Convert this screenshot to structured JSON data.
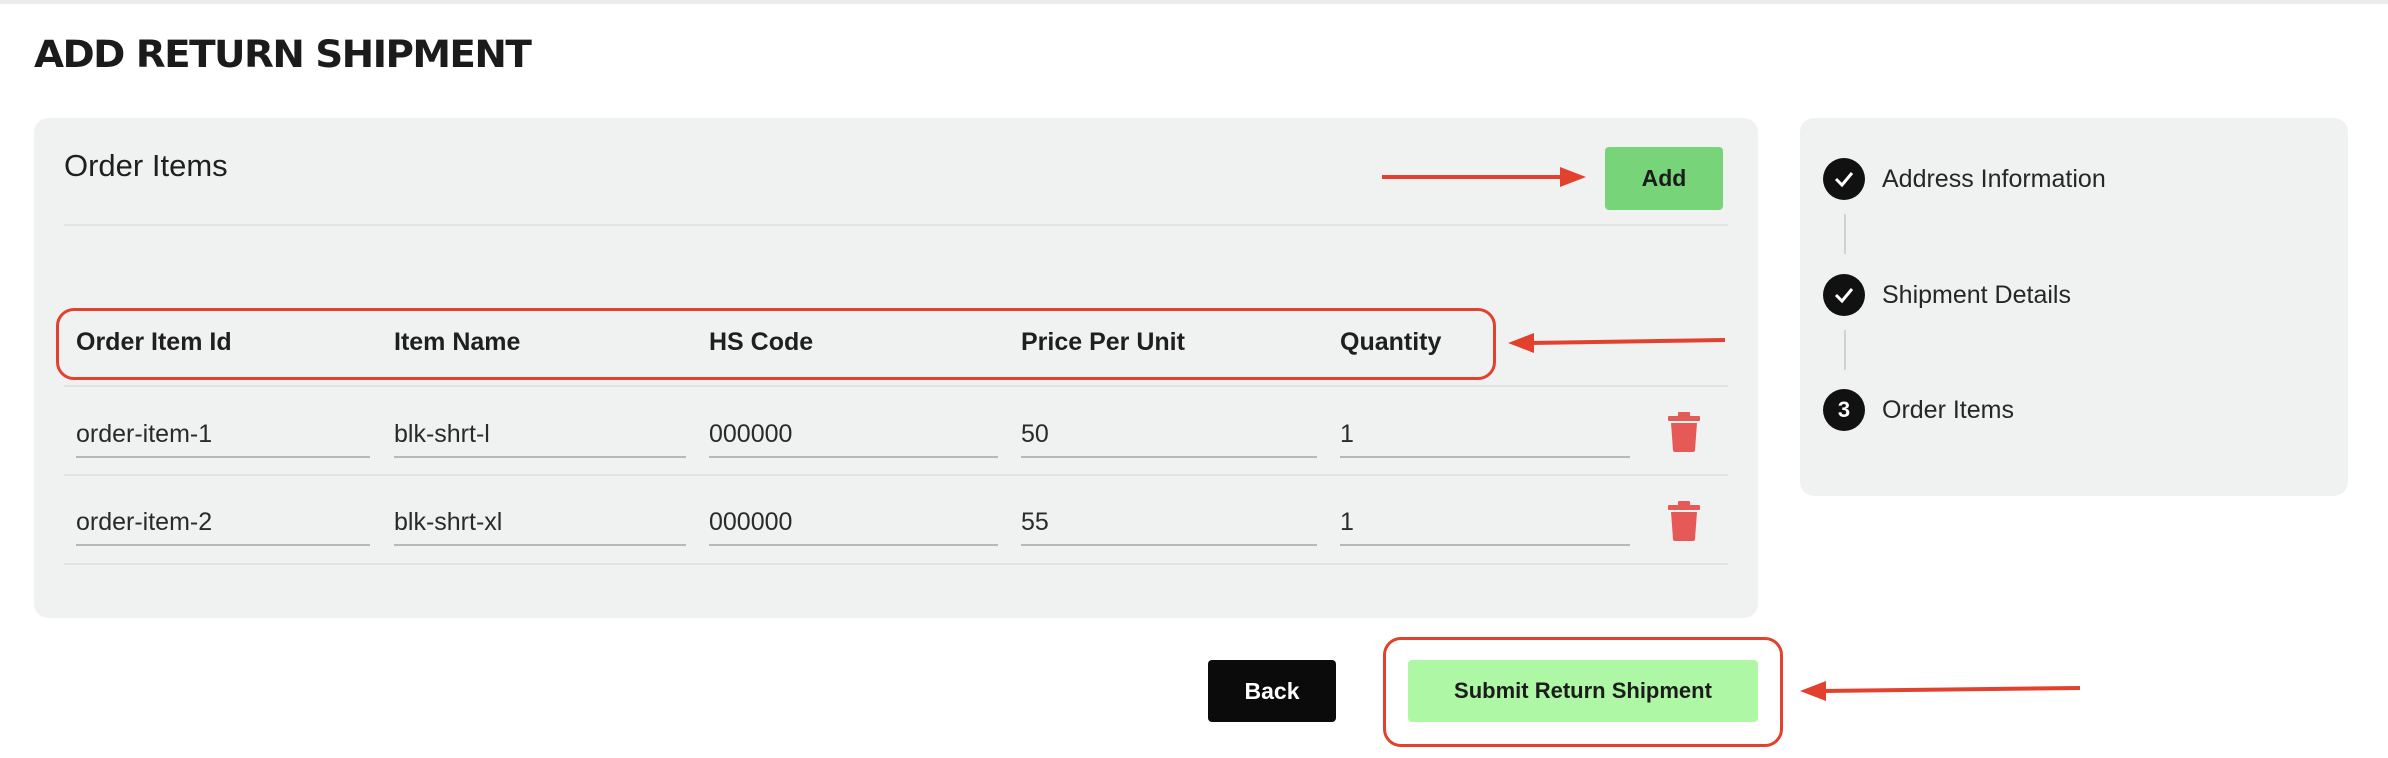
{
  "page": {
    "title": "ADD RETURN SHIPMENT"
  },
  "order_items_card": {
    "title": "Order Items",
    "add_label": "Add",
    "columns": [
      "Order Item Id",
      "Item Name",
      "HS Code",
      "Price Per Unit",
      "Quantity"
    ],
    "rows": [
      {
        "order_item_id": "order-item-1",
        "item_name": "blk-shrt-l",
        "hs_code": "000000",
        "price_per_unit": "50",
        "quantity": "1"
      },
      {
        "order_item_id": "order-item-2",
        "item_name": "blk-shrt-xl",
        "hs_code": "000000",
        "price_per_unit": "55",
        "quantity": "1"
      }
    ]
  },
  "steps": [
    {
      "label": "Address Information",
      "state": "complete",
      "marker": ""
    },
    {
      "label": "Shipment Details",
      "state": "complete",
      "marker": ""
    },
    {
      "label": "Order Items",
      "state": "current",
      "marker": "3"
    }
  ],
  "actions": {
    "back_label": "Back",
    "submit_label": "Submit Return Shipment"
  },
  "icons": {
    "delete": "trash-icon",
    "complete": "check-icon",
    "annotation": "arrow-icon"
  },
  "colors": {
    "add_button": "#78d478",
    "submit_button": "#aef7a4",
    "back_button": "#0b0b0b",
    "delete_icon": "#e55a57",
    "annotation": "#e2412d",
    "card_background": "#f0f2f1"
  }
}
